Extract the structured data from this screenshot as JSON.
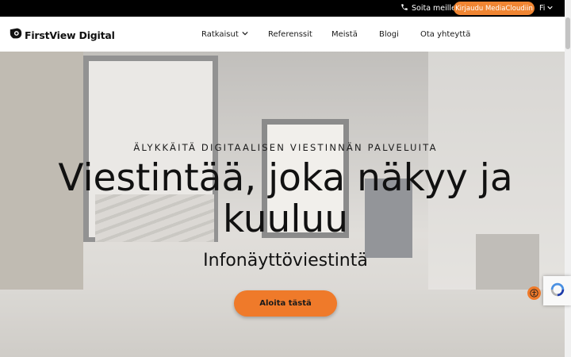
{
  "topbar": {
    "call_label": "Soita meille",
    "login_label": "Kirjaudu MediaCloudiin",
    "lang_label": "Fi"
  },
  "header": {
    "logo_text": "FirstView Digital",
    "nav": [
      "Ratkaisut",
      "Referenssit",
      "Meistä",
      "Blogi",
      "Ota yhteyttä"
    ]
  },
  "hero": {
    "eyebrow": "ÄLYKKÄITÄ DIGITAALISEN VIESTINNÄN PALVELUITA",
    "headline": "Viestintää, joka näkyy ja kuuluu",
    "subline": "Infonäyttöviestintä",
    "cta_label": "Aloita tästä"
  },
  "colors": {
    "accent": "#ef7a2a",
    "topbar_bg": "#000000"
  },
  "icons": [
    "phone-icon",
    "chevron-down-icon",
    "logo-icon",
    "accessibility-icon",
    "recaptcha-icon"
  ]
}
